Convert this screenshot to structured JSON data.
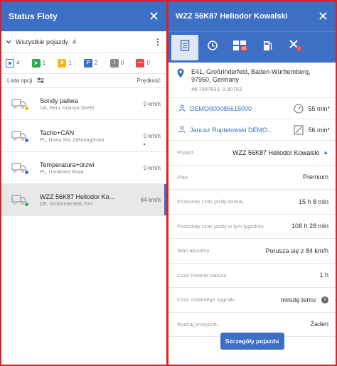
{
  "left": {
    "title": "Status Floty",
    "filter": {
      "label": "Wszystkie pojazdy",
      "count": "4"
    },
    "chips": [
      {
        "icon": "all-vehicles-icon",
        "count": "4",
        "color": "#3d6fc4"
      },
      {
        "icon": "moving-icon",
        "count": "1",
        "color": "#2eaa4f"
      },
      {
        "icon": "idle-icon",
        "count": "1",
        "color": "#f2b824"
      },
      {
        "icon": "parked-icon",
        "count": "2",
        "color": "#3d6fc4"
      },
      {
        "icon": "alert-icon",
        "count": "0",
        "color": "#8a8a8a"
      },
      {
        "icon": "offline-icon",
        "count": "0",
        "color": "#e24b4b"
      }
    ],
    "columns": {
      "list_options": "Lista opcji",
      "speed": "Prędkość"
    },
    "vehicles": [
      {
        "name": "Sondy paliwa",
        "address": "UA, Reni, Krainya Street",
        "speed": "0 km/h",
        "status_color": "#f2b824"
      },
      {
        "name": "Tacho+CAN",
        "address": "PL, Nowa Sól, Zielonogórska",
        "speed": "0 km/h",
        "status_color": "#3d6fc4"
      },
      {
        "name": "Temperatura+drzwi",
        "address": "PL, Unnamed Road",
        "speed": "0 km/h",
        "status_color": "#3d6fc4"
      },
      {
        "name": "WZZ 56K87 Heliodor Ko...",
        "address": "DE, Großrinderfeld, E41",
        "speed": "84 km/h",
        "status_color": "#2eaa4f"
      }
    ]
  },
  "right": {
    "title": "WZZ 56K87 Heliodor Kowalski",
    "tabs": [
      {
        "icon": "document-icon"
      },
      {
        "icon": "history-icon"
      },
      {
        "icon": "tacho-card-icon"
      },
      {
        "icon": "fuel-icon"
      },
      {
        "icon": "service-tools-icon"
      }
    ],
    "address": {
      "line1": "E41, Großrinderfeld, Baden-Württemberg,",
      "line2": "97950, Germany",
      "coords": "49.7097833, 9.80753"
    },
    "driver1": {
      "id": "DEMO000085615000",
      "time": "55 min*"
    },
    "driver2": {
      "name": "Janusz Ruptelowski DEMO...",
      "time": "56 min*"
    },
    "props": [
      {
        "key": "Pojazd",
        "value": "WZZ 56K87 Heliodor Kowalski"
      },
      {
        "key": "Plan",
        "value": "Premium"
      },
      {
        "key": "Pozostały czas jazdy dzisiaj",
        "value": "15 h 8 min"
      },
      {
        "key": "Pozostały czas jazdy w tym tygodniu",
        "value": "108 h 28 min"
      },
      {
        "key": "Stan aktualny",
        "value": "Porusza się z 84 km/h"
      },
      {
        "key": "Czas trwania statusu",
        "value": "1 h"
      },
      {
        "key": "Czas ostatniego sygnału",
        "value": "minutę temu"
      },
      {
        "key": "Rodzaj przejazdu",
        "value": "Żaden"
      }
    ],
    "details_button": "Szczegóły pojazdu"
  }
}
